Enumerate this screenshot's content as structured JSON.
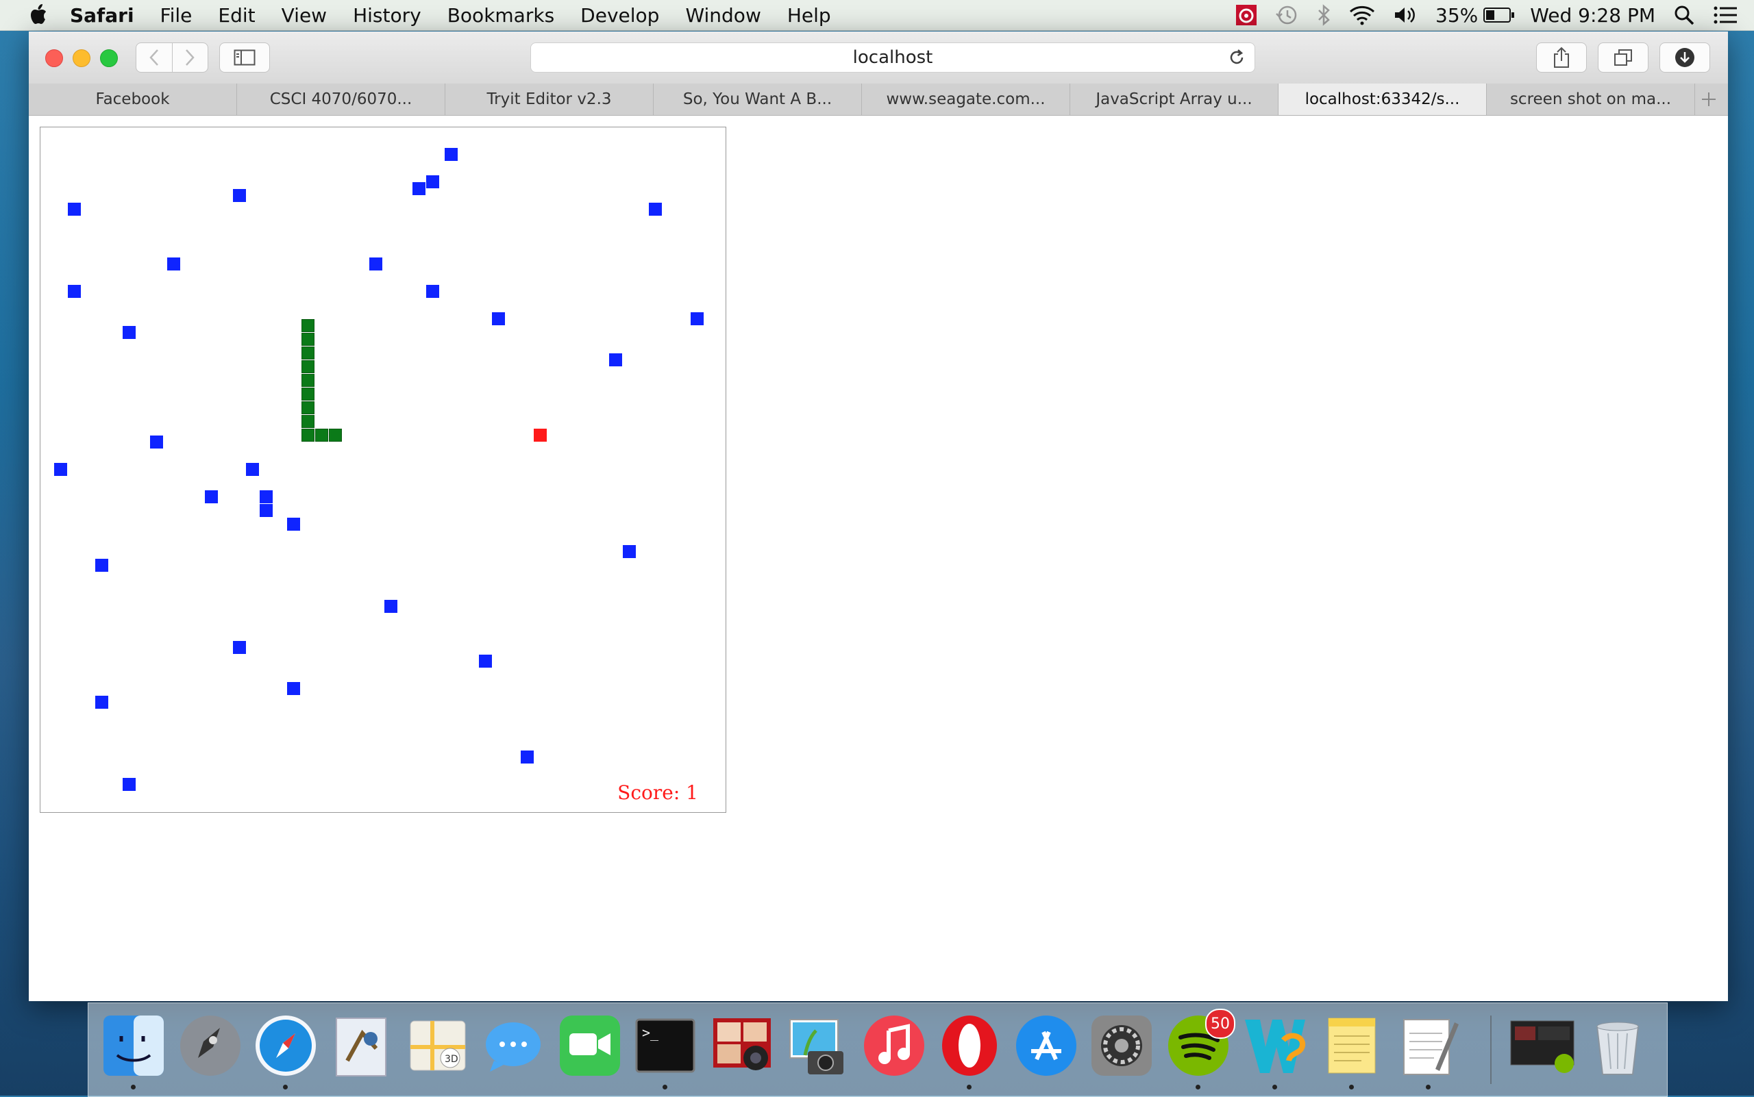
{
  "menubar": {
    "app_name": "Safari",
    "menus": [
      "File",
      "Edit",
      "View",
      "History",
      "Bookmarks",
      "Develop",
      "Window",
      "Help"
    ],
    "battery": "35%",
    "clock": "Wed 9:28 PM"
  },
  "toolbar": {
    "address": "localhost"
  },
  "tabs": [
    {
      "label": "Facebook"
    },
    {
      "label": "CSCI 4070/6070..."
    },
    {
      "label": "Tryit Editor v2.3"
    },
    {
      "label": "So, You Want A B..."
    },
    {
      "label": "www.seagate.com..."
    },
    {
      "label": "JavaScript Array u..."
    },
    {
      "label": "localhost:63342/s...",
      "active": true
    },
    {
      "label": "screen shot on ma..."
    }
  ],
  "game": {
    "score_text": "Score: 1",
    "colors": {
      "obstacle": "#0f24ff",
      "snake": "#0b7a18",
      "food": "#ff1a1a"
    }
  },
  "dock": {
    "items": [
      {
        "name": "finder",
        "running": true
      },
      {
        "name": "launchpad",
        "running": false
      },
      {
        "name": "safari",
        "running": true
      },
      {
        "name": "mail",
        "running": false
      },
      {
        "name": "maps",
        "running": false
      },
      {
        "name": "messages",
        "running": false
      },
      {
        "name": "facetime",
        "running": false
      },
      {
        "name": "terminal",
        "running": true
      },
      {
        "name": "photo-booth",
        "running": false
      },
      {
        "name": "iphoto",
        "running": false
      },
      {
        "name": "itunes",
        "running": false
      },
      {
        "name": "opera",
        "running": true
      },
      {
        "name": "app-store",
        "running": false
      },
      {
        "name": "system-preferences",
        "running": false
      },
      {
        "name": "spotify",
        "running": true,
        "badge": "50"
      },
      {
        "name": "webstorm",
        "running": true
      },
      {
        "name": "stickies",
        "running": true
      },
      {
        "name": "textedit",
        "running": true
      },
      {
        "name": "screenshot-thumbnail",
        "running": false
      },
      {
        "name": "trash",
        "running": false
      }
    ]
  }
}
